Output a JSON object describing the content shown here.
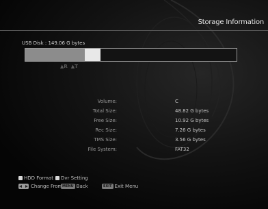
{
  "header": {
    "title": "Storage Information"
  },
  "disk": {
    "label": "USB Disk : 149.06 G bytes",
    "used_fraction": 0.3,
    "gap_start_fraction": 0.283,
    "gap_end_fraction": 0.355,
    "legend": [
      "▲R",
      "▲T"
    ]
  },
  "info": {
    "rows": [
      {
        "label": "Volume:",
        "value": "C"
      },
      {
        "label": "Total Size:",
        "value": "48.82 G bytes"
      },
      {
        "label": "Free Size:",
        "value": "10.92 G bytes"
      },
      {
        "label": "Rec Size:",
        "value": "7.26 G bytes"
      },
      {
        "label": "TMS Size:",
        "value": "3.56 G bytes"
      },
      {
        "label": "File System:",
        "value": "FAT32"
      }
    ]
  },
  "footer": {
    "hdd_format": "HDD Format",
    "dvr_setting": "Dvr Setting",
    "change_from": "Change From",
    "back_key": "MENU",
    "back_label": "Back",
    "exit_key": "EXIT",
    "exit_label": "Exit Menu"
  },
  "colors": {
    "background": "#000000",
    "text_primary": "#e6e6e6",
    "text_secondary": "#9a9a9a",
    "bar_border": "#9a9a9a",
    "bar_highlight": "#e8e8e8"
  }
}
